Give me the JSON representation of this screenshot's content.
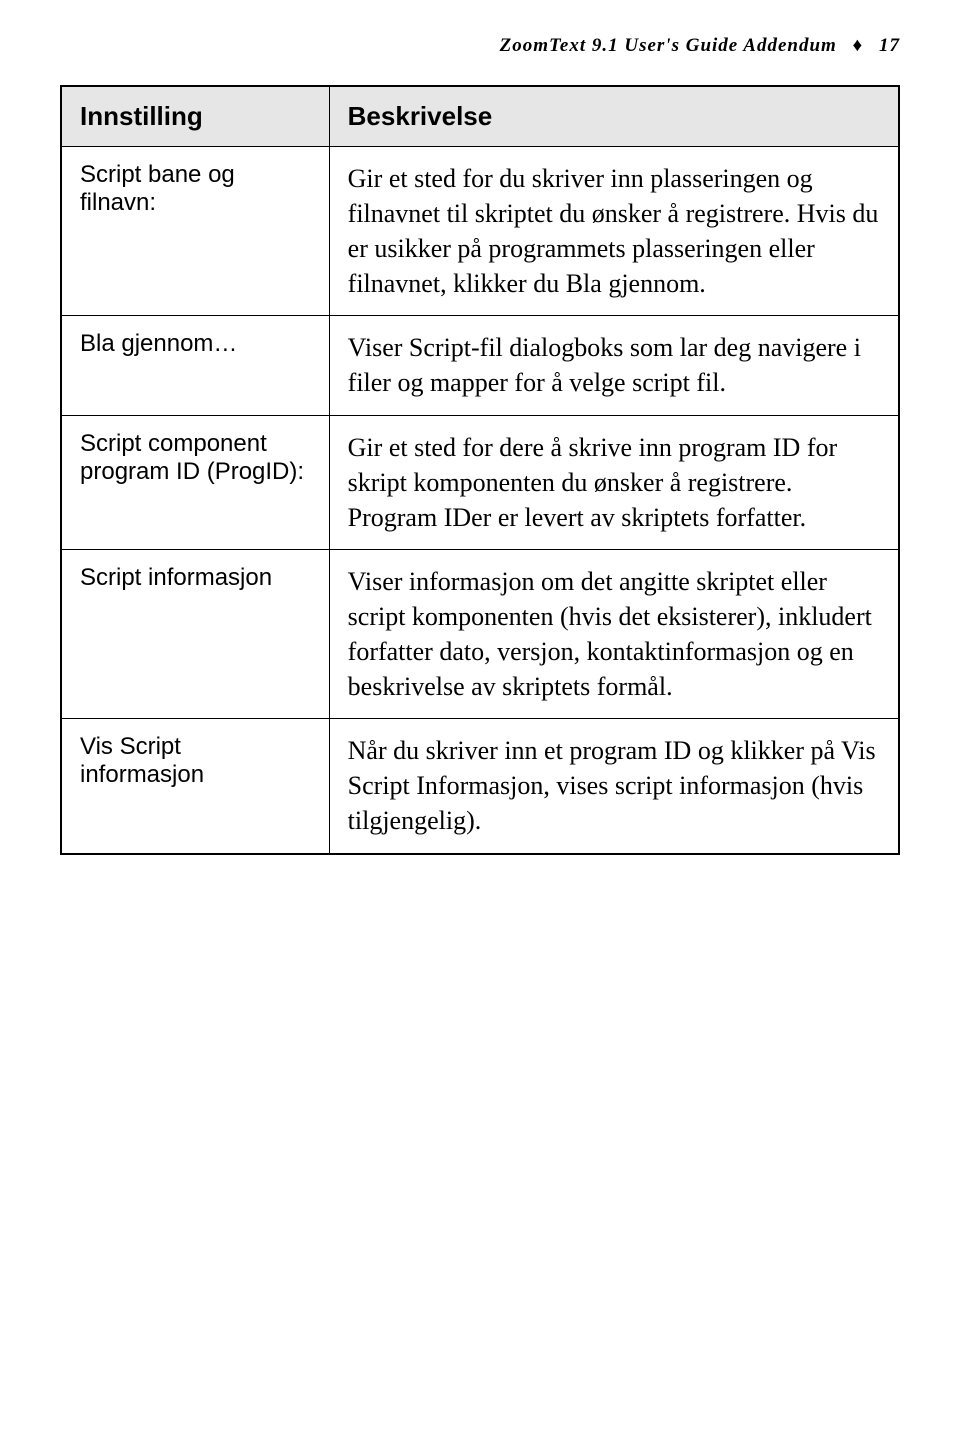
{
  "header": {
    "product": "ZoomText 9.1 User's Guide Addendum",
    "page": "17"
  },
  "table": {
    "columns": {
      "setting": "Innstilling",
      "description": "Beskrivelse"
    },
    "rows": [
      {
        "setting": "Script bane og filnavn:",
        "description": "Gir et sted for du skriver inn plasseringen og filnavnet til skriptet du ønsker å registrere. Hvis du er usikker på programmets plasseringen eller filnavnet, klikker du Bla gjennom."
      },
      {
        "setting": "Bla gjennom…",
        "description": "Viser Script-fil dialogboks som lar deg navigere i filer og mapper for å velge script fil."
      },
      {
        "setting": "Script component program ID (ProgID):",
        "description": "Gir et sted for dere å skrive inn program ID for skript komponenten du ønsker å registrere. Program IDer er levert av skriptets forfatter."
      },
      {
        "setting": "Script informasjon",
        "description": "Viser informasjon om det angitte skriptet eller script komponenten (hvis det eksisterer), inkludert forfatter dato, versjon, kontaktinformasjon og en beskrivelse av skriptets formål."
      },
      {
        "setting": "Vis Script informasjon",
        "description": "Når du skriver inn et program ID og klikker på Vis Script Informasjon, vises script informasjon (hvis tilgjengelig)."
      }
    ]
  }
}
